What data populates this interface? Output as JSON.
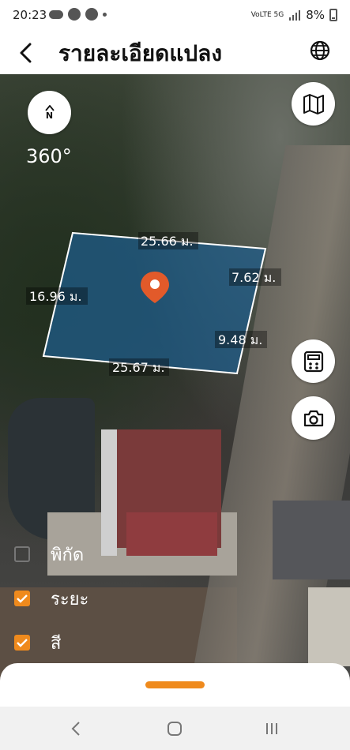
{
  "status_bar": {
    "time": "20:23",
    "signal_label": "VoLTE 5G",
    "battery": "8%"
  },
  "app_bar": {
    "title": "รายละเอียดแปลง"
  },
  "map": {
    "heading": "360°",
    "compass_letter": "N",
    "measurements": {
      "top": "25.66 ม.",
      "right_top": "7.62 ม.",
      "left": "16.96 ม.",
      "right_bottom": "9.48 ม.",
      "bottom": "25.67 ม."
    },
    "parcel_color": "#1f5c8a",
    "pin_color": "#e25a2a"
  },
  "layers": [
    {
      "label": "พิกัด",
      "checked": false
    },
    {
      "label": "ระยะ",
      "checked": true
    },
    {
      "label": "สี",
      "checked": true
    }
  ],
  "colors": {
    "accent": "#ef8a1d"
  }
}
